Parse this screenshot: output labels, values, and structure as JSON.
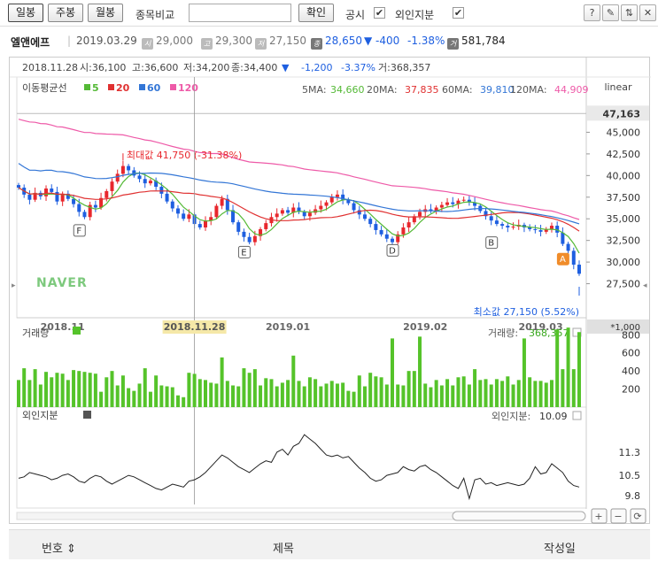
{
  "toolbar": {
    "period_buttons": [
      "일봉",
      "주봉",
      "월봉"
    ],
    "compare_label": "종목비교",
    "compare_input": "",
    "confirm_button": "확인",
    "disclosure_label": "공시",
    "foreign_label": "외인지분",
    "check_mark": "✔",
    "tool_icons": [
      "?",
      "✎",
      "⇅",
      "✕"
    ]
  },
  "quote": {
    "name": "엘앤에프",
    "date": "2019.03.29",
    "open": "29,000",
    "high": "29,300",
    "low": "27,150",
    "close": "28,650",
    "change": "▼ -400",
    "change_pct": "-1.38%",
    "volume": "581,784",
    "icon_open": "시",
    "icon_high": "고",
    "icon_low": "저",
    "icon_close": "종",
    "icon_volume": "거"
  },
  "colors": {
    "up": "#e8272d",
    "down": "#1e5fe0",
    "ma5": "#54b936",
    "ma20": "#e03131",
    "ma60": "#3376d6",
    "ma120": "#ee5aa8",
    "volume_bar": "#55c32a",
    "foreign_line": "#222222"
  },
  "chart_data": {
    "type": "candlestick",
    "info_line": {
      "date": "2018.11.28",
      "open": "시:36,100",
      "high": "고:36,600",
      "low": "저:34,200",
      "close": "종:34,400",
      "arrow": "▼",
      "change": "-1,200",
      "change_pct": "-3.37%",
      "volume": "거:368,357"
    },
    "ma_legend": {
      "title": "이동평균선",
      "items": [
        {
          "name": "5",
          "color": "#54b936"
        },
        {
          "name": "20",
          "color": "#e03131"
        },
        {
          "name": "60",
          "color": "#3376d6"
        },
        {
          "name": "120",
          "color": "#ee5aa8"
        }
      ],
      "values": [
        {
          "label": "5MA:",
          "value": "34,660"
        },
        {
          "label": "20MA:",
          "value": "37,835"
        },
        {
          "label": "60MA:",
          "value": "39,810"
        },
        {
          "label": "120MA:",
          "value": "44,909"
        }
      ]
    },
    "scale_type": "linear",
    "current_price_label": "47,163",
    "price_ylim": [
      25000,
      47500
    ],
    "price_ticks": [
      27500,
      30000,
      32500,
      35000,
      37500,
      40000,
      42500,
      45000
    ],
    "price_tick_labels": [
      "27,500",
      "30,000",
      "32,500",
      "35,000",
      "37,500",
      "40,000",
      "42,500",
      "45,000"
    ],
    "x_labels": [
      "2018.11",
      "2019.01",
      "2019.02",
      "2019.03"
    ],
    "crosshair_date": "2018.11.28",
    "crosshair_index": 32,
    "annotation_max": "최대값 41,750 (-31.38%)",
    "annotation_min": "최소값 27,150 (5.52%)",
    "watermark": "NAVER",
    "event_markers": [
      {
        "label": "F",
        "index": 11,
        "price": 33700
      },
      {
        "label": "E",
        "index": 41,
        "price": 31200
      },
      {
        "label": "D",
        "index": 68,
        "price": 31400
      },
      {
        "label": "B",
        "index": 86,
        "price": 32300
      },
      {
        "label": "A",
        "index": 99,
        "price": 30400
      }
    ],
    "closes": [
      38600,
      37800,
      37200,
      38000,
      37600,
      38500,
      38100,
      37000,
      37900,
      37300,
      36700,
      35800,
      35200,
      36600,
      36300,
      37400,
      38200,
      39300,
      40200,
      41100,
      40600,
      40000,
      39600,
      39100,
      39400,
      38700,
      37900,
      37000,
      36200,
      35600,
      35000,
      35500,
      34400,
      34000,
      34800,
      35200,
      36500,
      37300,
      36000,
      34600,
      33500,
      32900,
      32300,
      33000,
      33800,
      34500,
      35200,
      35600,
      36000,
      35700,
      36300,
      35800,
      35300,
      35700,
      36100,
      36500,
      36900,
      37500,
      37800,
      37200,
      36800,
      36000,
      35500,
      35000,
      34400,
      33700,
      33200,
      32700,
      32300,
      33200,
      34000,
      34600,
      35300,
      35800,
      36100,
      35900,
      36300,
      36600,
      36900,
      36700,
      37100,
      37200,
      36900,
      36500,
      35900,
      35300,
      34800,
      34400,
      34200,
      34000,
      34100,
      34300,
      34000,
      33800,
      33700,
      33500,
      33800,
      34200,
      33400,
      32100,
      31300,
      29700,
      28650
    ],
    "volume_unit": "*1,000",
    "volume_title": "거래량",
    "volume_value_label": "거래량:",
    "volume_value": "368,357",
    "volume_ticks": [
      200,
      400,
      600,
      800
    ],
    "volume_ylim": [
      0,
      950
    ],
    "volumes": [
      300,
      430,
      300,
      420,
      250,
      390,
      330,
      380,
      370,
      300,
      410,
      400,
      390,
      380,
      370,
      170,
      330,
      400,
      240,
      350,
      210,
      180,
      260,
      430,
      170,
      350,
      240,
      230,
      220,
      130,
      110,
      380,
      368,
      310,
      300,
      270,
      260,
      550,
      290,
      240,
      230,
      430,
      380,
      420,
      240,
      320,
      310,
      230,
      270,
      300,
      570,
      290,
      230,
      330,
      310,
      230,
      260,
      290,
      260,
      270,
      180,
      170,
      350,
      230,
      380,
      340,
      330,
      250,
      760,
      250,
      240,
      400,
      400,
      780,
      260,
      220,
      300,
      240,
      310,
      240,
      330,
      340,
      250,
      420,
      300,
      310,
      250,
      310,
      290,
      340,
      250,
      300,
      760,
      330,
      290,
      290,
      270,
      300,
      860,
      420,
      880,
      420,
      830
    ],
    "foreign_title": "외인지분",
    "foreign_value_label": "외인지분:",
    "foreign_value": "10.09",
    "foreign_ticks": [
      9.8,
      10.5,
      11.3
    ],
    "foreign_ylim": [
      9.5,
      12.3
    ],
    "foreign": [
      10.4,
      10.45,
      10.6,
      10.55,
      10.5,
      10.45,
      10.35,
      10.4,
      10.5,
      10.55,
      10.45,
      10.3,
      10.25,
      10.4,
      10.5,
      10.45,
      10.3,
      10.2,
      10.3,
      10.4,
      10.5,
      10.45,
      10.35,
      10.25,
      10.15,
      10.05,
      10.0,
      10.1,
      10.2,
      10.15,
      10.1,
      10.3,
      10.35,
      10.45,
      10.6,
      10.8,
      11.0,
      11.2,
      11.1,
      10.95,
      10.8,
      10.7,
      10.6,
      10.75,
      10.9,
      11.0,
      10.95,
      11.3,
      11.4,
      11.2,
      11.5,
      11.6,
      11.9,
      11.75,
      11.6,
      11.4,
      11.2,
      11.15,
      11.2,
      11.1,
      11.15,
      10.95,
      10.75,
      10.6,
      10.4,
      10.3,
      10.35,
      10.5,
      10.55,
      10.6,
      10.8,
      10.7,
      10.65,
      10.8,
      10.85,
      10.7,
      10.6,
      10.45,
      10.3,
      10.15,
      10.05,
      10.4,
      9.7,
      10.35,
      10.4,
      10.2,
      10.25,
      10.15,
      10.2,
      10.25,
      10.2,
      10.15,
      10.2,
      10.4,
      10.8,
      10.55,
      10.6,
      10.9,
      10.75,
      10.6,
      10.3,
      10.15,
      10.1
    ]
  },
  "grid_header": {
    "col_no": "번호 ⇕",
    "col_title": "제목",
    "col_date": "작성일"
  },
  "zoom_buttons": [
    "+",
    "−",
    "⟳"
  ]
}
